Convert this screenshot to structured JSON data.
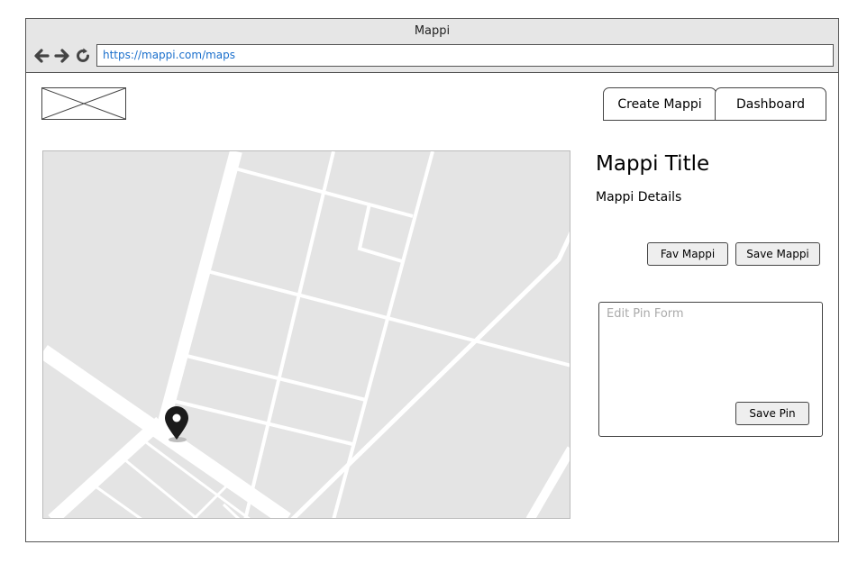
{
  "browser": {
    "title": "Mappi",
    "url": "https://mappi.com/maps"
  },
  "header": {
    "logo_icon": "image-placeholder-icon",
    "nav": [
      {
        "label": "Create Mappi"
      },
      {
        "label": "Dashboard"
      }
    ]
  },
  "map": {
    "icon": "map-pin-icon"
  },
  "details": {
    "title": "Mappi Title",
    "description": "Mappi Details",
    "fav_label": "Fav Mappi",
    "save_label": "Save Mappi"
  },
  "pin_form": {
    "placeholder": "Edit Pin Form",
    "save_label": "Save Pin"
  },
  "colors": {
    "link": "#1a6fcc",
    "map_bg": "#e4e4e4",
    "button_bg": "#eeeeee"
  }
}
